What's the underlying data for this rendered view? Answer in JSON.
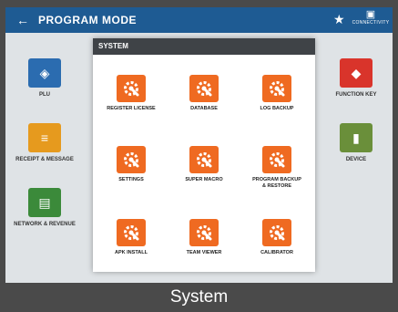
{
  "topbar": {
    "title": "PROGRAM MODE",
    "connection_label": "CONNECTIVITY"
  },
  "background_tiles": [
    {
      "label": "PLU",
      "color": "#2b6cb0"
    },
    {
      "label": "RECEIPT & MESSAGE",
      "color": "#e69a1e"
    },
    {
      "label": "NETWORK & REVENUE",
      "color": "#3b8a3a"
    },
    {
      "label": "FUNCTION KEY",
      "color": "#d9342b"
    },
    {
      "label": "DEVICE",
      "color": "#6a8f3a"
    }
  ],
  "dialog": {
    "title": "SYSTEM",
    "items": [
      {
        "label": "REGISTER LICENSE",
        "icon": "gear-wrench-icon"
      },
      {
        "label": "DATABASE",
        "icon": "gear-wrench-icon"
      },
      {
        "label": "LOG BACKUP",
        "icon": "gear-wrench-icon"
      },
      {
        "label": "SETTINGS",
        "icon": "gear-wrench-icon"
      },
      {
        "label": "SUPER MACRO",
        "icon": "gear-wrench-icon"
      },
      {
        "label": "PROGRAM BACKUP & RESTORE",
        "icon": "gear-wrench-icon"
      },
      {
        "label": "APK INSTALL",
        "icon": "gear-wrench-icon"
      },
      {
        "label": "TEAM VIEWER",
        "icon": "gear-wrench-icon"
      },
      {
        "label": "CALIBRATOR",
        "icon": "gear-wrench-icon"
      }
    ]
  },
  "caption": "System",
  "colors": {
    "accent": "#ef6a21",
    "topbar": "#1e5b93",
    "dialog_header": "#3f4347"
  }
}
